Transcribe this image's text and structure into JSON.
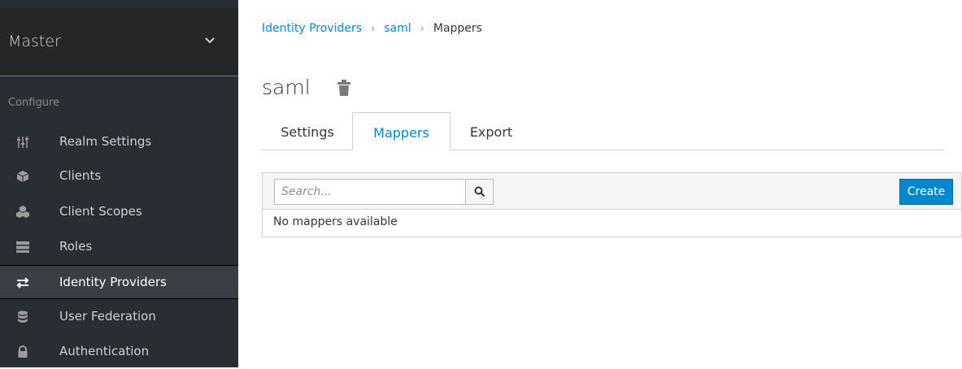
{
  "sidebar": {
    "realm": "Master",
    "section_label": "Configure",
    "items": [
      {
        "label": "Realm Settings",
        "icon": "sliders-icon"
      },
      {
        "label": "Clients",
        "icon": "cube-icon"
      },
      {
        "label": "Client Scopes",
        "icon": "cubes-icon"
      },
      {
        "label": "Roles",
        "icon": "list-icon"
      },
      {
        "label": "Identity Providers",
        "icon": "exchange-icon"
      },
      {
        "label": "User Federation",
        "icon": "database-icon"
      },
      {
        "label": "Authentication",
        "icon": "lock-icon"
      }
    ]
  },
  "breadcrumb": {
    "items": [
      "Identity Providers",
      "saml",
      "Mappers"
    ],
    "separator": "›"
  },
  "page": {
    "title": "saml"
  },
  "tabs": [
    {
      "label": "Settings"
    },
    {
      "label": "Mappers"
    },
    {
      "label": "Export"
    }
  ],
  "toolbar": {
    "search_placeholder": "Search...",
    "create_label": "Create"
  },
  "table": {
    "empty_message": "No mappers available"
  },
  "colors": {
    "accent": "#0088ce",
    "sidebar_bg": "#292e34"
  }
}
